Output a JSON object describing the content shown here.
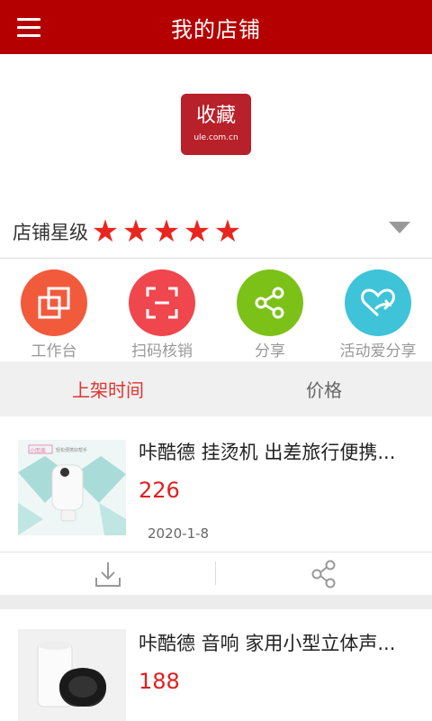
{
  "header": {
    "title": "我的店铺",
    "menu_icon": "hamburger-menu-icon"
  },
  "store": {
    "logo_text": "收藏",
    "logo_subtext": "ule.com.cn",
    "rating_label": "店铺星级",
    "stars": 5,
    "max_stars": 5,
    "accent_color": "#b50000"
  },
  "actions": [
    {
      "label": "工作台",
      "icon": "workbench-icon",
      "color": "#f25a3c"
    },
    {
      "label": "扫码核销",
      "icon": "scan-icon",
      "color": "#f0464d"
    },
    {
      "label": "分享",
      "icon": "share-icon",
      "color": "#7cc117"
    },
    {
      "label": "活动爱分享",
      "icon": "heart-share-icon",
      "color": "#3ec3d8"
    }
  ],
  "sort_tabs": [
    {
      "label": "上架时间",
      "active": true
    },
    {
      "label": "价格",
      "active": false
    }
  ],
  "products": [
    {
      "title": "咔酷德 挂烫机 出差旅行便携...",
      "price": "226",
      "date": "2020-1-8",
      "thumb_badge": "小而美",
      "thumb_caption": "轻松便携好帮手"
    },
    {
      "title": "咔酷德 音响 家用小型立体声...",
      "price": "188",
      "date": ""
    }
  ],
  "card_actions": {
    "download_icon": "download-icon",
    "share_icon": "share-icon"
  }
}
